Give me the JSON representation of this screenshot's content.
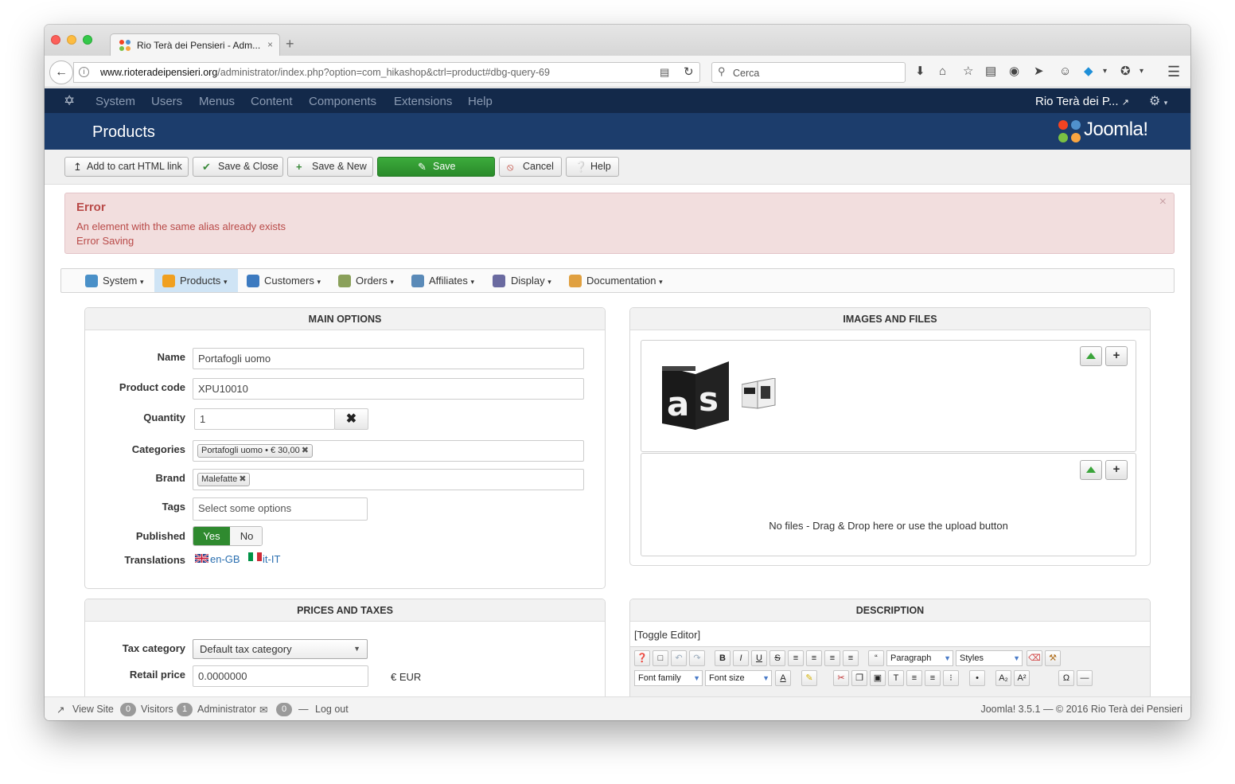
{
  "browser": {
    "tab_title": "Rio Terà dei Pensieri - Adm...",
    "tab_close": "×",
    "new_tab": "+",
    "url_domain": "www.rioteradeipensieri.org",
    "url_path": "/administrator/index.php?option=com_hikashop&ctrl=product#dbg-query-69",
    "search_placeholder": "Cerca"
  },
  "admin_nav": {
    "items": [
      "System",
      "Users",
      "Menus",
      "Content",
      "Components",
      "Extensions",
      "Help"
    ],
    "site_link": "Rio Terà dei P..."
  },
  "header": {
    "page_title": "Products",
    "brand": "Joomla!"
  },
  "toolbar": {
    "add_to_cart": "Add to cart HTML link",
    "save_close": "Save & Close",
    "save_new": "Save & New",
    "save": "Save",
    "cancel": "Cancel",
    "help": "Help"
  },
  "alert": {
    "heading": "Error",
    "message_1": "An element with the same alias already exists",
    "message_2": "Error Saving",
    "close": "×"
  },
  "hikashop_menu": [
    {
      "label": "System",
      "color": "#4a90c8"
    },
    {
      "label": "Products",
      "color": "#f0a020"
    },
    {
      "label": "Customers",
      "color": "#3c7ac0"
    },
    {
      "label": "Orders",
      "color": "#8aa05a"
    },
    {
      "label": "Affiliates",
      "color": "#5a8ab8"
    },
    {
      "label": "Display",
      "color": "#6a6aa0"
    },
    {
      "label": "Documentation",
      "color": "#e0a040"
    }
  ],
  "main_options": {
    "title": "MAIN OPTIONS",
    "name_label": "Name",
    "name_value": "Portafogli uomo",
    "code_label": "Product code",
    "code_value": "XPU10010",
    "quantity_label": "Quantity",
    "quantity_value": "1",
    "categories_label": "Categories",
    "category_chip": "Portafogli uomo • € 30,00",
    "brand_label": "Brand",
    "brand_chip": "Malefatte",
    "tags_label": "Tags",
    "tags_placeholder": "Select some options",
    "published_label": "Published",
    "published_yes": "Yes",
    "published_no": "No",
    "translations_label": "Translations",
    "translation_en": "en-GB",
    "translation_it": "it-IT"
  },
  "images_files": {
    "title": "IMAGES AND FILES",
    "no_files": "No files - Drag & Drop here or use the upload button"
  },
  "prices": {
    "title": "PRICES AND TAXES",
    "tax_label": "Tax category",
    "tax_value": "Default tax category",
    "retail_label": "Retail price",
    "retail_value": "0.0000000",
    "currency": "€ EUR"
  },
  "description": {
    "title": "DESCRIPTION",
    "toggle": "[Toggle Editor]",
    "paragraph": "Paragraph",
    "styles": "Styles",
    "font_family": "Font family",
    "font_size": "Font size"
  },
  "status_bar": {
    "view_site": "View Site",
    "visitors_count": "0",
    "visitors_label": "Visitors",
    "admin_count": "1",
    "admin_label": "Administrator",
    "messages_count": "0",
    "logout": "Log out",
    "version": "Joomla! 3.5.1  —  © 2016 Rio Terà dei Pensieri"
  }
}
